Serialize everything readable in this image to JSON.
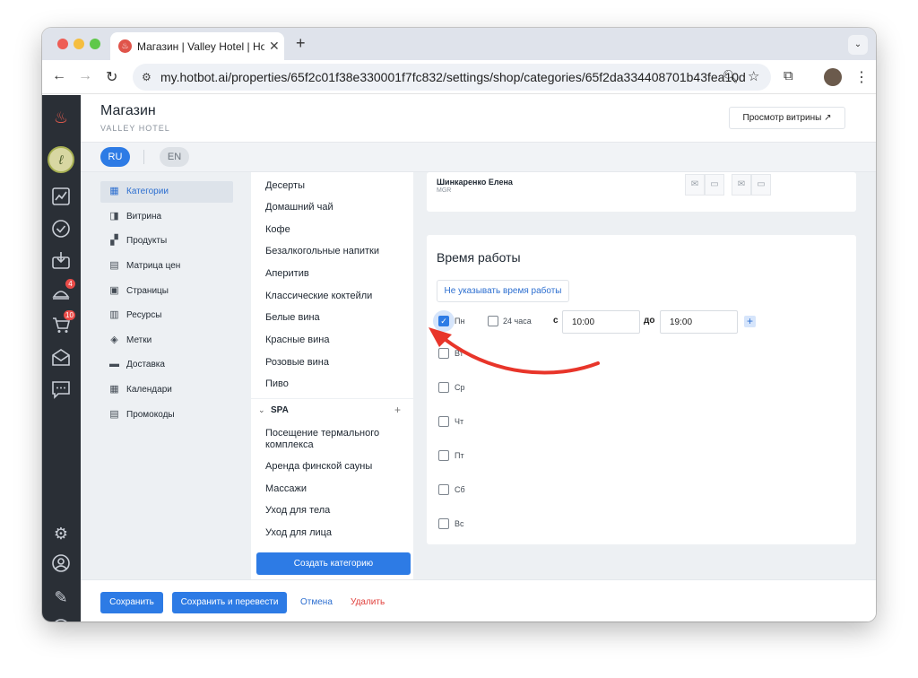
{
  "browser": {
    "tab_title": "Магазин | Valley Hotel | Hotbot",
    "url": "my.hotbot.ai/properties/65f2c01f38e330001f7fc832/settings/shop/categories/65f2da334408701b43fea10d"
  },
  "rail": {
    "badge_inbox": "4",
    "badge_cart": "10"
  },
  "header": {
    "title": "Магазин",
    "subtitle": "VALLEY HOTEL",
    "view_shop_label": "Просмотр витрины ↗"
  },
  "languages": {
    "ru": "RU",
    "en": "EN"
  },
  "sidenav": {
    "items": [
      {
        "label": "Категории",
        "icon": "storefront-icon"
      },
      {
        "label": "Витрина",
        "icon": "tags-icon"
      },
      {
        "label": "Продукты",
        "icon": "grid-icon"
      },
      {
        "label": "Матрица цен",
        "icon": "calculator-icon"
      },
      {
        "label": "Страницы",
        "icon": "page-icon"
      },
      {
        "label": "Ресурсы",
        "icon": "resources-icon"
      },
      {
        "label": "Метки",
        "icon": "label-icon"
      },
      {
        "label": "Доставка",
        "icon": "truck-icon"
      },
      {
        "label": "Календари",
        "icon": "calendar-icon"
      },
      {
        "label": "Промокоды",
        "icon": "promo-icon"
      }
    ]
  },
  "categories": {
    "items": [
      "Десерты",
      "Домашний чай",
      "Кофе",
      "Безалкогольные напитки",
      "Аперитив",
      "Классические коктейли",
      "Белые вина",
      "Красные вина",
      "Розовые вина",
      "Пиво"
    ],
    "group_name": "SPA",
    "group_items": [
      "Посещение термального комплекса",
      "Аренда финской сауны",
      "Массажи",
      "Уход для тела",
      "Уход для лица"
    ],
    "create_label": "Создать категорию"
  },
  "staff": {
    "name": "Шинкаренко Елена",
    "role": "MGR"
  },
  "hours": {
    "title": "Время работы",
    "no_hours_label": "Не указывать время работы",
    "label_24h": "24 часа",
    "label_from": "с",
    "label_to": "до",
    "from_value": "10:00",
    "to_value": "19:00",
    "days": [
      "Пн",
      "Вт",
      "Ср",
      "Чт",
      "Пт",
      "Сб",
      "Вс"
    ]
  },
  "footer": {
    "save": "Сохранить",
    "save_translate": "Сохранить и перевести",
    "cancel": "Отмена",
    "delete": "Удалить"
  }
}
